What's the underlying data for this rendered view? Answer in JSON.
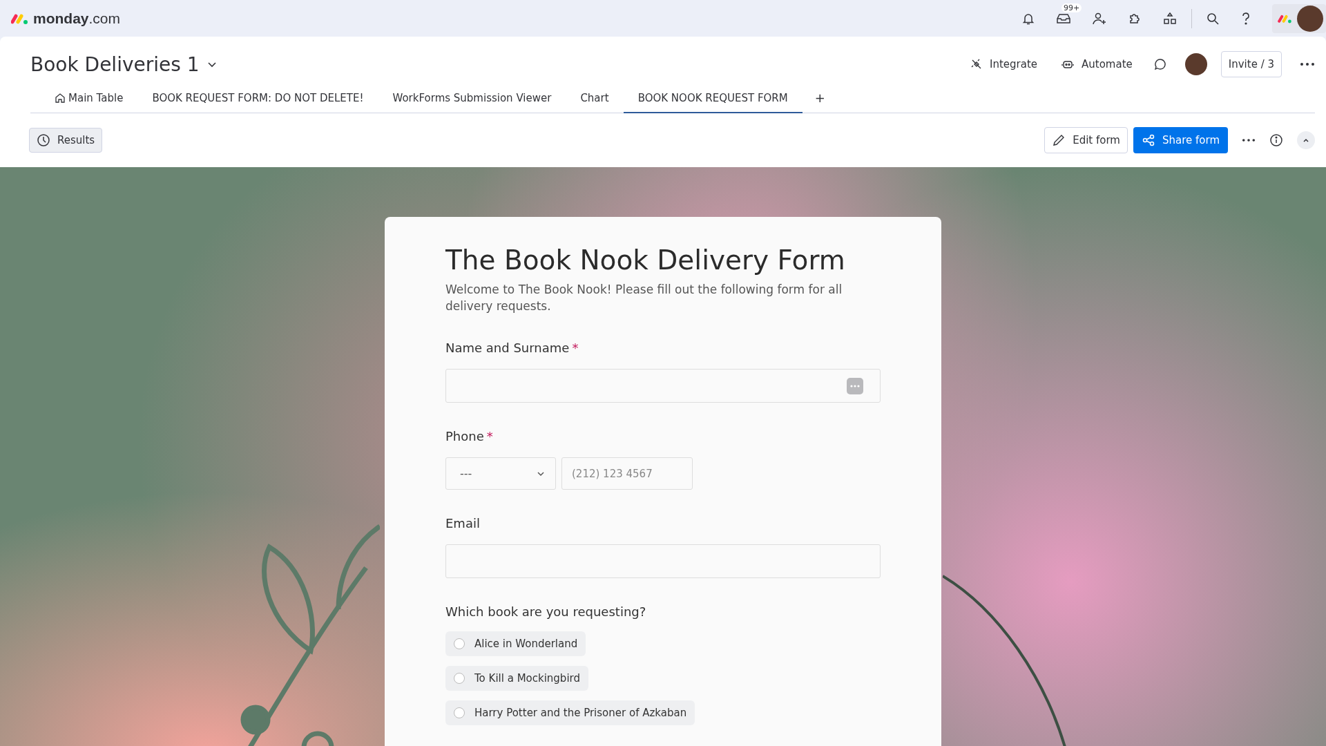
{
  "top_bar": {
    "logo": "**monday**.com",
    "inbox_badge": "99+"
  },
  "board": {
    "title": "Book Deliveries 1",
    "actions": {
      "integrate": "Integrate",
      "automate": "Automate",
      "invite": "Invite / 3"
    },
    "tabs": [
      {
        "label": "Main Table",
        "kind": "home",
        "selected": false
      },
      {
        "label": "BOOK REQUEST FORM: DO NOT DELETE!",
        "kind": "plain",
        "selected": false
      },
      {
        "label": "WorkForms Submission Viewer",
        "kind": "plain",
        "selected": false
      },
      {
        "label": "Chart",
        "kind": "plain",
        "selected": false
      },
      {
        "label": "BOOK NOOK REQUEST FORM",
        "kind": "plain",
        "selected": true
      }
    ],
    "add_tab": "+"
  },
  "toolbar": {
    "results": "Results",
    "edit_form": "Edit form",
    "share_form": "Share form"
  },
  "form": {
    "title": "The Book Nook Delivery Form",
    "description": "Welcome to The Book Nook! Please fill out the following form for all delivery requests.",
    "fields": [
      {
        "kind": "text",
        "label": "Name and Surname",
        "required_mark": "*",
        "has_icon": true
      },
      {
        "kind": "phone",
        "label": "Phone",
        "required_mark": "*",
        "country": "---",
        "placeholder": "(212) 123 4567"
      },
      {
        "kind": "text",
        "label": "Email",
        "has_icon": false
      },
      {
        "kind": "radio",
        "label": "Which book are you requesting?",
        "options": [
          {
            "label": "Alice in Wonderland",
            "selected": false
          },
          {
            "label": "To Kill a Mockingbird",
            "selected": false
          },
          {
            "label": "Harry Potter and the Prisoner of Azkaban",
            "selected": false
          }
        ]
      }
    ]
  }
}
